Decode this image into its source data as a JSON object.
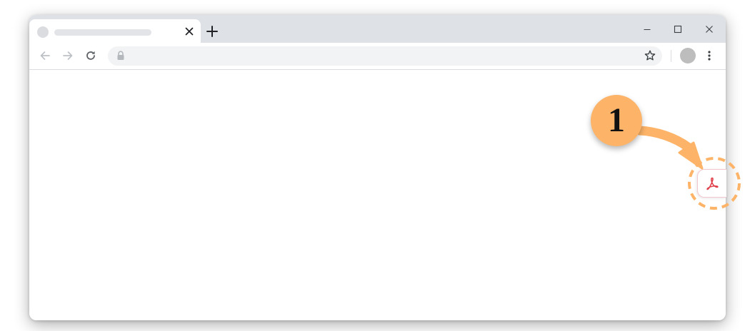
{
  "browser": {
    "tab": {
      "close_icon": "close-icon",
      "new_tab_icon": "plus-icon"
    },
    "window_controls": [
      "minimize-icon",
      "maximize-icon",
      "close-icon"
    ],
    "toolbar": {
      "back_icon": "arrow-left-icon",
      "forward_icon": "arrow-right-icon",
      "reload_icon": "reload-icon",
      "lock_icon": "lock-icon",
      "bookmark_icon": "star-icon",
      "menu_icon": "kebab-menu-icon"
    }
  },
  "extension": {
    "icon": "adobe-acrobat-icon",
    "icon_color": "#e0414c"
  },
  "annotation": {
    "step_number": "1",
    "badge_color": "#fdb468",
    "text_color": "#111111"
  }
}
